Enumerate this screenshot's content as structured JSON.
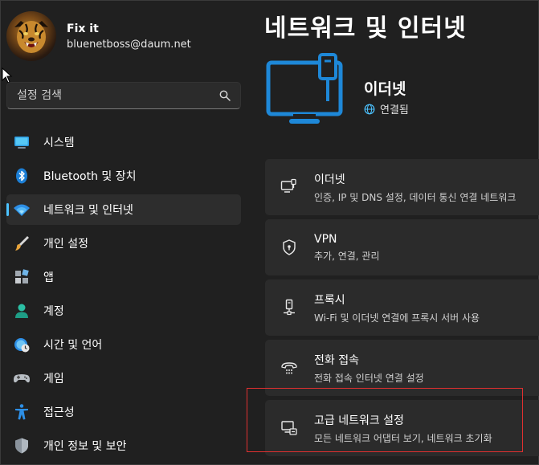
{
  "user": {
    "name": "Fix it",
    "email": "bluenetboss@daum.net",
    "avatar_icon": "tiger-avatar"
  },
  "search": {
    "placeholder": "설정 검색",
    "icon": "search-icon"
  },
  "nav": {
    "items": [
      {
        "label": "시스템",
        "icon": "monitor-icon"
      },
      {
        "label": "Bluetooth 및 장치",
        "icon": "bluetooth-icon"
      },
      {
        "label": "네트워크 및 인터넷",
        "icon": "wifi-icon",
        "selected": true
      },
      {
        "label": "개인 설정",
        "icon": "brush-icon"
      },
      {
        "label": "앱",
        "icon": "apps-icon"
      },
      {
        "label": "계정",
        "icon": "person-icon"
      },
      {
        "label": "시간 및 언어",
        "icon": "clock-globe-icon"
      },
      {
        "label": "게임",
        "icon": "gamepad-icon"
      },
      {
        "label": "접근성",
        "icon": "accessibility-icon"
      },
      {
        "label": "개인 정보 및 보안",
        "icon": "shield-icon"
      }
    ]
  },
  "main": {
    "title": "네트워크 및 인터넷",
    "hero": {
      "title": "이더넷",
      "status": "연결됨",
      "status_icon": "globe-icon"
    },
    "cards": [
      {
        "title": "이더넷",
        "desc": "인증, IP 및 DNS 설정, 데이터 통신 연결 네트워크",
        "icon": "ethernet-icon"
      },
      {
        "title": "VPN",
        "desc": "추가, 연결, 관리",
        "icon": "vpn-shield-icon"
      },
      {
        "title": "프록시",
        "desc": "Wi-Fi 및 이더넷 연결에 프록시 서버 사용",
        "icon": "proxy-icon"
      },
      {
        "title": "전화 접속",
        "desc": "전화 접속 인터넷 연결 설정",
        "icon": "dialup-icon"
      },
      {
        "title": "고급 네트워크 설정",
        "desc": "모든 네트워크 어댑터 보기, 네트워크 초기화",
        "icon": "advanced-network-icon"
      }
    ]
  },
  "colors": {
    "background": "#202020",
    "card": "#2b2b2b",
    "accent": "#4cc2ff",
    "highlight": "#e03030"
  }
}
